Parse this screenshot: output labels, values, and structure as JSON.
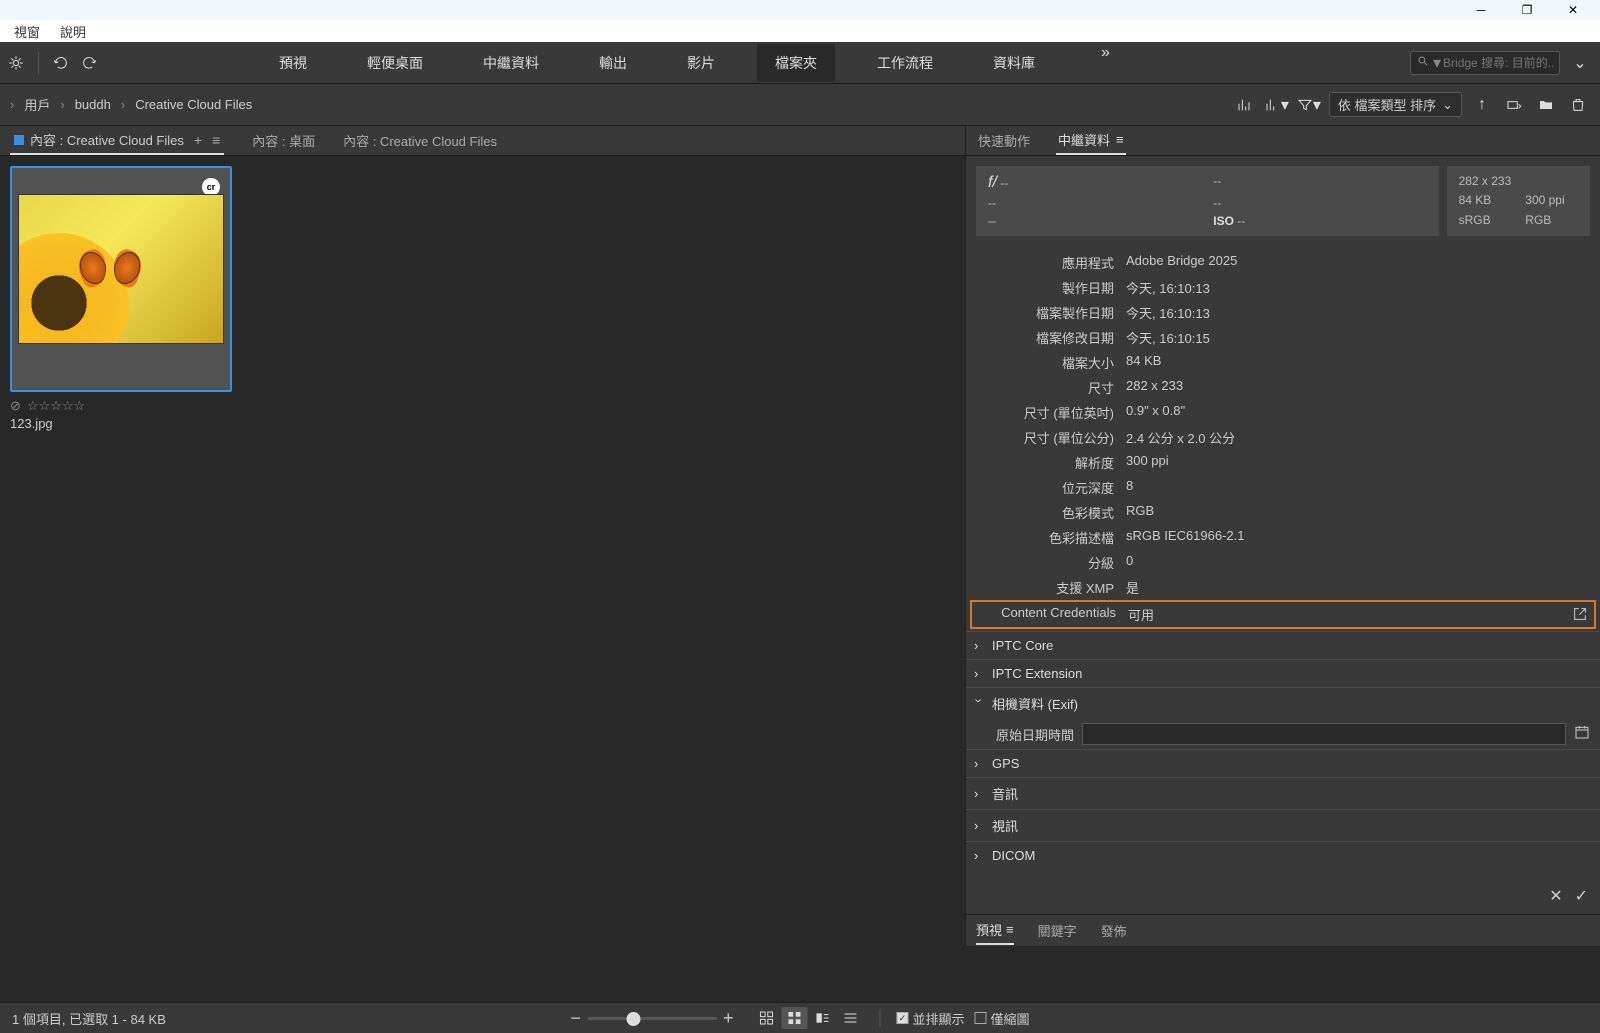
{
  "window": {
    "menu": {
      "window": "視窗",
      "help": "說明"
    }
  },
  "toolbar": {
    "tabs": {
      "preview": "預視",
      "essentials": "輕便桌面",
      "metadata": "中繼資料",
      "output": "輸出",
      "video": "影片",
      "folder": "檔案夾",
      "workflow": "工作流程",
      "library": "資料庫"
    },
    "search_placeholder": "Bridge 搜尋: 目前的.."
  },
  "breadcrumb": {
    "user": "用戶",
    "buddh": "buddh",
    "ccfiles": "Creative Cloud Files"
  },
  "sort_label": "依 檔案類型 排序",
  "panel_tabs": {
    "content_cc": "內容 : Creative Cloud Files",
    "content_desktop": "內容 : 桌面",
    "content_cc2": "內容 : Creative Cloud Files"
  },
  "thumb": {
    "badge": "cr",
    "filename": "123.jpg",
    "stars": "☆☆☆☆☆"
  },
  "right_tabs": {
    "quick_actions": "快速動作",
    "metadata": "中繼資料"
  },
  "meta_summary": {
    "f": "f/",
    "dash": "--",
    "iso": "ISO",
    "dim": "282 x 233",
    "size": "84 KB",
    "ppi": "300 ppi",
    "srgb": "sRGB",
    "rgb": "RGB"
  },
  "meta": {
    "app_label": "應用程式",
    "app_value": "Adobe Bridge 2025",
    "created_label": "製作日期",
    "created_value": "今天, 16:10:13",
    "file_created_label": "檔案製作日期",
    "file_created_value": "今天, 16:10:13",
    "file_modified_label": "檔案修改日期",
    "file_modified_value": "今天, 16:10:15",
    "filesize_label": "檔案大小",
    "filesize_value": "84 KB",
    "dim_label": "尺寸",
    "dim_value": "282 x 233",
    "dim_in_label": "尺寸 (單位英吋)",
    "dim_in_value": "0.9\" x 0.8\"",
    "dim_cm_label": "尺寸 (單位公分)",
    "dim_cm_value": "2.4 公分 x 2.0 公分",
    "res_label": "解析度",
    "res_value": "300 ppi",
    "depth_label": "位元深度",
    "depth_value": "8",
    "mode_label": "色彩模式",
    "mode_value": "RGB",
    "profile_label": "色彩描述檔",
    "profile_value": "sRGB IEC61966-2.1",
    "rating_label": "分級",
    "rating_value": "0",
    "xmp_label": "支援 XMP",
    "xmp_value": "是",
    "cc_label": "Content Credentials",
    "cc_value": "可用"
  },
  "sections": {
    "iptc_core": "IPTC Core",
    "iptc_ext": "IPTC Extension",
    "camera": "相機資料 (Exif)",
    "camera_date_label": "原始日期時間",
    "gps": "GPS",
    "audio": "音訊",
    "video": "視訊",
    "dicom": "DICOM"
  },
  "bottom_tabs": {
    "preview": "預視",
    "keywords": "關鍵字",
    "publish": "發佈"
  },
  "status": {
    "items": "1 個項目, 已選取 1 - 84 KB",
    "side_by_side": "並排顯示",
    "thumbnail_only": "僅縮圖"
  }
}
